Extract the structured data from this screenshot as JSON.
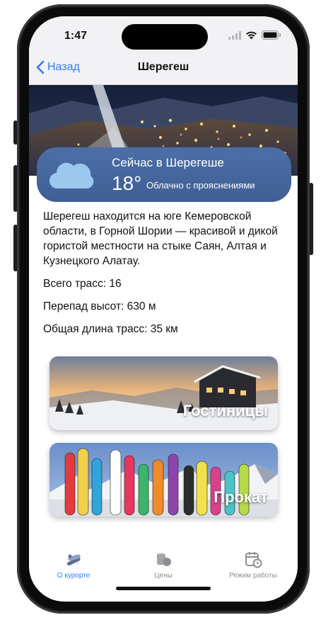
{
  "status": {
    "time": "1:47"
  },
  "nav": {
    "back_label": "Назад",
    "title": "Шерегеш"
  },
  "weather": {
    "title": "Сейчас в Шерегеше",
    "temperature": "18°",
    "condition": "Облачно с прояснениями",
    "icon": "cloud-icon"
  },
  "info": {
    "description": "Шерегеш находится на юге Кемеровской области, в Горной Шории — красивой и дикой гористой местности на стыке Саян, Алтая и Кузнецкого Алатау.",
    "trails": "Всего трасс: 16",
    "elevation": "Перепад высот: 630 м",
    "length": "Общая длина трасс: 35 км"
  },
  "cards": {
    "hotels": "Гостиницы",
    "rental": "Прокат"
  },
  "tabs": [
    {
      "label": "О курорте",
      "icon": "ski-icon",
      "active": true
    },
    {
      "label": "Цены",
      "icon": "coins-icon",
      "active": false
    },
    {
      "label": "Режим работы",
      "icon": "calendar-clock-icon",
      "active": false
    }
  ],
  "colors": {
    "accent": "#2f7bf5",
    "weather_card": "#4d6fa6"
  }
}
